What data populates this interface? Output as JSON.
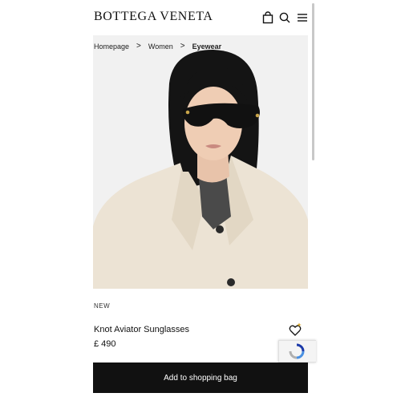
{
  "header": {
    "brand": "BOTTEGA VENETA",
    "icons": [
      "shopping-bag-icon",
      "search-icon",
      "menu-icon"
    ]
  },
  "breadcrumb": {
    "items": [
      "Homepage",
      "Women",
      "Eyewear"
    ],
    "separator": ">"
  },
  "product": {
    "badge": "NEW",
    "name": "Knot Aviator Sunglasses",
    "price": "£ 490",
    "cta_label": "Add to shopping bag"
  },
  "colors": {
    "button_bg": "#111111",
    "button_text": "#ffffff",
    "image_bg": "#f1f1f1"
  }
}
